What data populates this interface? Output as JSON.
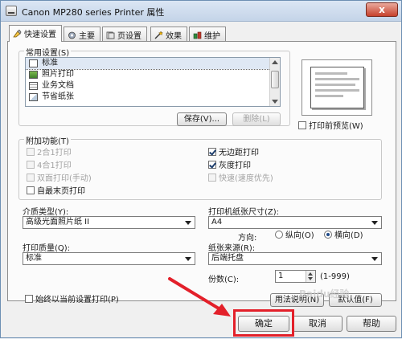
{
  "window": {
    "title": "Canon MP280 series Printer 属性",
    "close_label": "x"
  },
  "tabs": [
    {
      "label": "快速设置",
      "icon": "quick-setup-icon",
      "active": true
    },
    {
      "label": "主要",
      "icon": "main-icon",
      "active": false
    },
    {
      "label": "页设置",
      "icon": "page-setup-icon",
      "active": false
    },
    {
      "label": "效果",
      "icon": "effects-icon",
      "active": false
    },
    {
      "label": "维护",
      "icon": "maintenance-icon",
      "active": false
    }
  ],
  "common_settings": {
    "label": "常用设置(S)",
    "items": [
      {
        "label": "标准",
        "icon": "document-icon",
        "selected": true
      },
      {
        "label": "照片打印",
        "icon": "photo-icon",
        "selected": false
      },
      {
        "label": "业务文档",
        "icon": "business-document-icon",
        "selected": false
      },
      {
        "label": "节省纸张",
        "icon": "paper-saving-icon",
        "selected": false
      }
    ],
    "save_label": "保存(V)...",
    "delete_label": "删除(L)"
  },
  "preview": {
    "checkbox_label": "打印前预览(W)",
    "checked": false
  },
  "additional": {
    "label": "附加功能(T)",
    "left": [
      {
        "label": "2合1打印",
        "checked": false,
        "disabled": true
      },
      {
        "label": "4合1打印",
        "checked": false,
        "disabled": true
      },
      {
        "label": "双面打印(手动)",
        "checked": false,
        "disabled": true
      },
      {
        "label": "自最末页打印",
        "checked": false,
        "disabled": false
      }
    ],
    "right": [
      {
        "label": "无边距打印",
        "checked": true,
        "disabled": false
      },
      {
        "label": "灰度打印",
        "checked": true,
        "disabled": false
      },
      {
        "label": "快速(速度优先)",
        "checked": false,
        "disabled": true
      }
    ]
  },
  "media_type": {
    "label": "介质类型(Y):",
    "value": "高级光面照片纸 II"
  },
  "paper_size": {
    "label": "打印机纸张尺寸(Z):",
    "value": "A4"
  },
  "orientation": {
    "label": "方向:",
    "portrait": "纵向(O)",
    "landscape": "横向(D)",
    "selected": "landscape"
  },
  "print_quality": {
    "label": "打印质量(Q):",
    "value": "标准"
  },
  "paper_source": {
    "label": "纸张来源(R):",
    "value": "后端托盘"
  },
  "copies": {
    "label": "份数(C):",
    "value": "1",
    "range": "(1-999)"
  },
  "always_print": {
    "label": "始终以当前设置打印(P)",
    "checked": false
  },
  "panel_buttons": {
    "instructions": "用法说明(N)",
    "defaults": "默认值(F)"
  },
  "dialog_buttons": {
    "ok": "确定",
    "cancel": "取消",
    "help": "帮助"
  },
  "watermark_text": "Baidu经验",
  "colors": {
    "highlight": "#e3202a",
    "accent": "#1f4b8a"
  }
}
